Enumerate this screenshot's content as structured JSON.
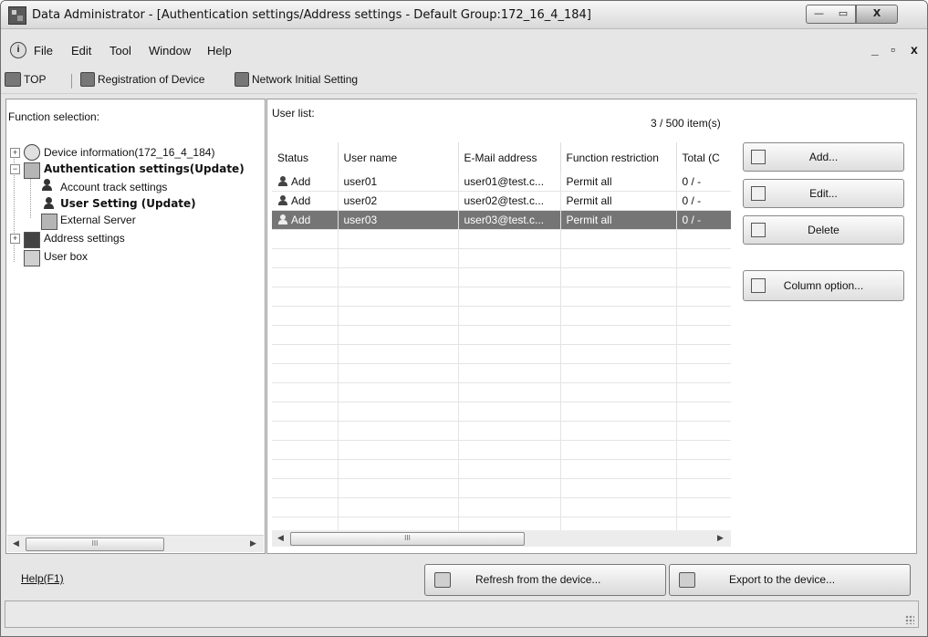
{
  "window": {
    "title": "Data Administrator - [Authentication settings/Address settings - Default Group:172_16_4_184]",
    "min_glyph": "—",
    "max_glyph": "▭",
    "close_glyph": "X"
  },
  "menu": {
    "items": [
      "File",
      "Edit",
      "Tool",
      "Window",
      "Help"
    ],
    "mdi_min": "_",
    "mdi_restore": "ð",
    "mdi_close": "x"
  },
  "toolbar": {
    "top_label": "TOP",
    "register_label": "Registration of Device",
    "network_label": "Network Initial Setting"
  },
  "left": {
    "label": "Function selection:",
    "tree": {
      "device_info": "Device information(172_16_4_184)",
      "auth": "Authentication settings(Update)",
      "account_track": "Account track settings",
      "user_setting": "User Setting (Update)",
      "external_server": "External Server",
      "address": "Address settings",
      "user_box": "User box"
    },
    "expander_plus": "+",
    "expander_minus": "−"
  },
  "userlist": {
    "label": "User list:",
    "count": "3 / 500 item(s)",
    "columns": [
      "Status",
      "User name",
      "E-Mail address",
      "Function restriction",
      "Total (C"
    ],
    "rows": [
      {
        "status": "Add",
        "name": "user01",
        "email": "user01@test.c...",
        "func": "Permit all",
        "total": "0 / -"
      },
      {
        "status": "Add",
        "name": "user02",
        "email": "user02@test.c...",
        "func": "Permit all",
        "total": "0 / -"
      },
      {
        "status": "Add",
        "name": "user03",
        "email": "user03@test.c...",
        "func": "Permit all",
        "total": "0 / -"
      }
    ],
    "selected_row": 2
  },
  "buttons": {
    "add": "Add...",
    "edit": "Edit...",
    "delete": "Delete",
    "column_option": "Column option...",
    "refresh": "Refresh from the device...",
    "export": "Export to the device...",
    "help": "Help(F1)"
  },
  "scroll": {
    "left_arrow": "◀",
    "right_arrow": "▶",
    "thumb_grip": "III"
  },
  "colors": {
    "selected_row": "#757575",
    "window_bg": "#e6e6e6"
  }
}
